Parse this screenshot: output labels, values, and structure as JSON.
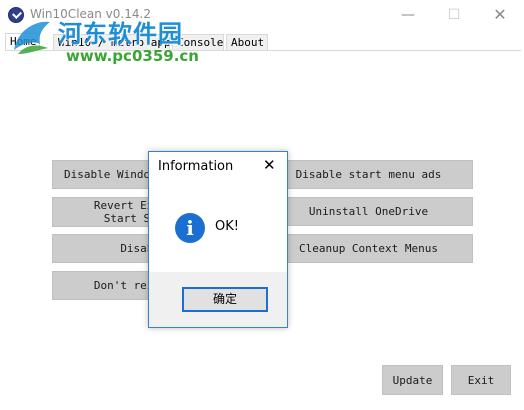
{
  "window": {
    "title": "Win10Clean v0.14.2",
    "minimize": "—",
    "maximize": "☐",
    "close": "✕"
  },
  "watermark": {
    "line1": "河东软件园",
    "line2": "www.pc0359.cn"
  },
  "tabs": [
    {
      "label": "Home",
      "active": true
    },
    {
      "label": "Win10 / metro apps",
      "active": false
    },
    {
      "label": "Console",
      "active": false
    },
    {
      "label": "About",
      "active": false
    }
  ],
  "actions": {
    "disable_windows_defender": "Disable Windows Defender",
    "revert_explorer": "Revert Explorer\nStart Screen",
    "disable_misc": "Disable",
    "dont_reinstall": "Don't reinstall",
    "disable_start_menu_ads": "Disable start menu ads",
    "uninstall_onedrive": "Uninstall OneDrive",
    "cleanup_context_menus": "Cleanup Context Menus",
    "update": "Update",
    "exit": "Exit"
  },
  "dialog": {
    "title": "Information",
    "close": "✕",
    "icon": "info-icon",
    "icon_glyph": "i",
    "message": "OK!",
    "ok_label": "确定"
  },
  "colors": {
    "accent": "#1a6fd0",
    "button_grey": "#cccccc",
    "watermark_blue": "#1e8fd6",
    "watermark_green": "#3aa534"
  }
}
